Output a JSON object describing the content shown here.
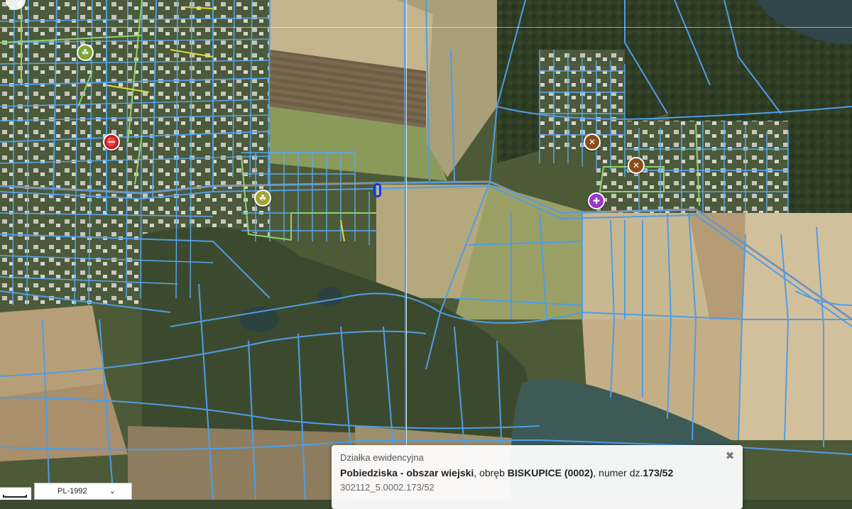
{
  "map": {
    "colors": {
      "parcel_line": "#4f9de6",
      "parcel_line_fill": "none",
      "road_primary": "#c98a5a",
      "building_outline": "#7ab6ee",
      "street_green": "#8fd16d",
      "street_yellow": "#e6d830",
      "lake": "#3b5f63",
      "forest": "#2e3d24",
      "field_light": "#b8a27c",
      "field_dark": "#6b5d43",
      "meadow": "#6f7e45"
    },
    "pois": [
      {
        "name": "poi-green-amenity",
        "icon": "tree-icon",
        "color": "#7da736",
        "glyph": "☘"
      },
      {
        "name": "poi-red-stop",
        "icon": "bus-stop-icon",
        "color": "#c4202a",
        "glyph": "⛔"
      },
      {
        "name": "poi-green-2",
        "icon": "tree-icon",
        "color": "#a2a536",
        "glyph": "☘"
      },
      {
        "name": "poi-brown-1",
        "icon": "road-sign-icon",
        "color": "#8a4d1a",
        "glyph": "✕"
      },
      {
        "name": "poi-brown-2",
        "icon": "road-sign-icon",
        "color": "#8a4d1a",
        "glyph": "✕"
      },
      {
        "name": "poi-purple",
        "icon": "church-icon",
        "color": "#9c35c9",
        "glyph": "✚"
      }
    ],
    "selected_marker_color": "#1437e6"
  },
  "crs": {
    "value": "PL-1992",
    "chevron": "⌄"
  },
  "popup": {
    "kind": "Działka ewidencyjna",
    "place": "Pobiedziska - obszar wiejski",
    "precinct_label": ", obręb ",
    "precinct": "BISKUPICE (0002)",
    "number_label": ", numer dz.",
    "number": "173/52",
    "identifier": "302112_5.0002.173/52",
    "close": "✖"
  }
}
